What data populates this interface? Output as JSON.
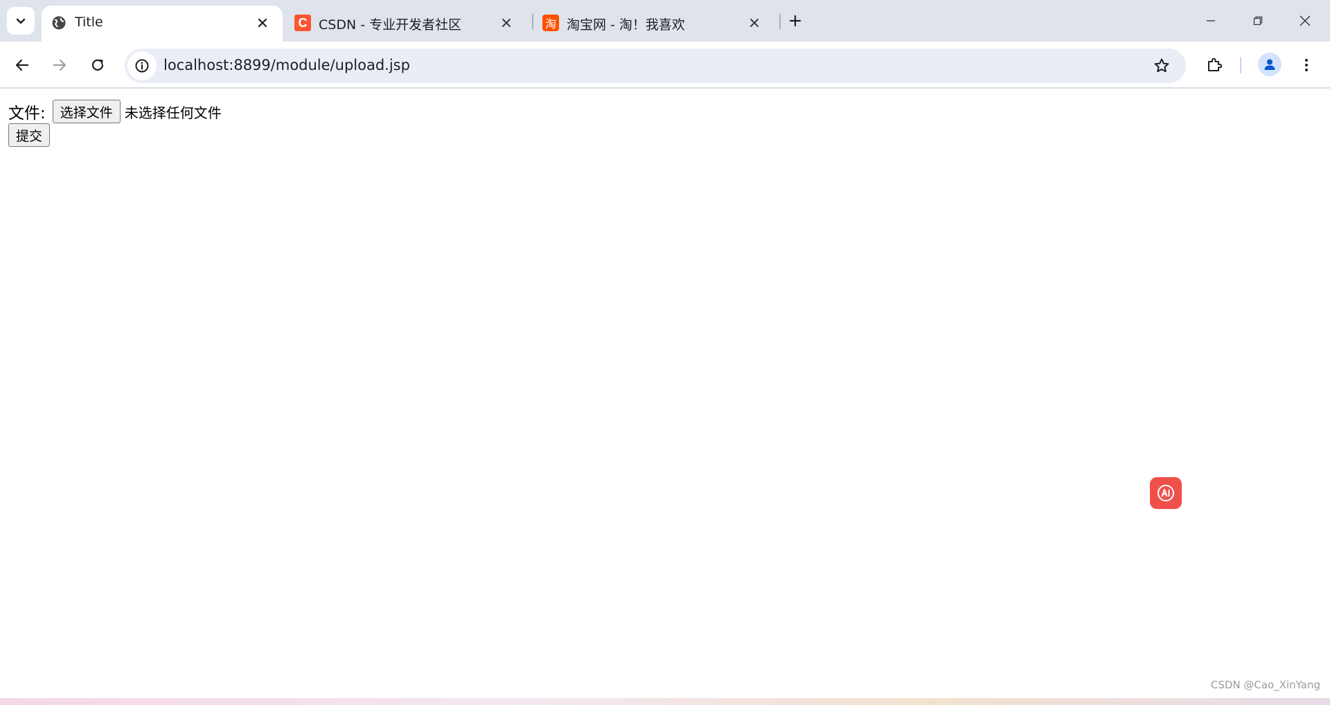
{
  "browser": {
    "tabs": [
      {
        "title": "Title",
        "favicon": "globe-icon",
        "active": true
      },
      {
        "title": "CSDN - 专业开发者社区",
        "favicon": "csdn-logo-icon",
        "favicon_letter": "C",
        "favicon_color": "#fc5531",
        "active": false
      },
      {
        "title": "淘宝网 - 淘！我喜欢",
        "favicon": "taobao-logo-icon",
        "favicon_letter": "淘",
        "favicon_color": "#ff5000",
        "active": false
      }
    ],
    "address_bar": {
      "url": "localhost:8899/module/upload.jsp"
    }
  },
  "page": {
    "file_label": "文件:",
    "choose_file_button": "选择文件",
    "no_file_text": "未选择任何文件",
    "submit_button": "提交"
  },
  "watermark": "CSDN @Cao_XinYang",
  "colors": {
    "ai_button": "#f0504a",
    "accent": "#0b57d0"
  }
}
